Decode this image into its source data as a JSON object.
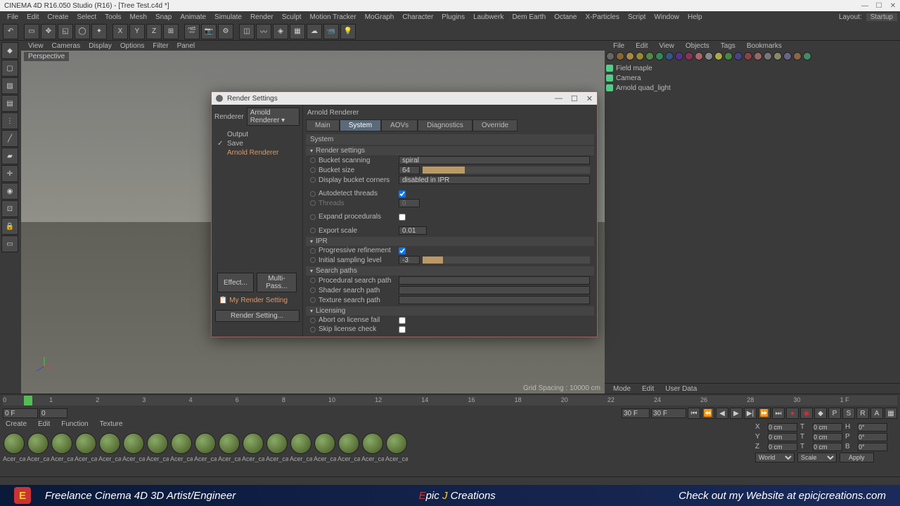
{
  "titlebar": {
    "text": "CINEMA 4D R16.050 Studio (R16) - [Tree Test.c4d *]"
  },
  "menus": [
    "File",
    "Edit",
    "Create",
    "Select",
    "Tools",
    "Mesh",
    "Snap",
    "Animate",
    "Simulate",
    "Render",
    "Sculpt",
    "Motion Tracker",
    "MoGraph",
    "Character",
    "Plugins",
    "Laubwerk",
    "Dem Earth",
    "Octane",
    "X-Particles",
    "Script",
    "Window",
    "Help"
  ],
  "layout": {
    "label": "Layout:",
    "value": "Startup"
  },
  "viewport_menus": [
    "View",
    "Cameras",
    "Display",
    "Options",
    "Filter",
    "Panel"
  ],
  "viewport": {
    "label": "Perspective",
    "grid_spacing": "Grid Spacing : 10000 cm"
  },
  "right_tabs": [
    "File",
    "Edit",
    "View",
    "Objects",
    "Tags",
    "Bookmarks"
  ],
  "objects": [
    {
      "name": "Field maple"
    },
    {
      "name": "Camera"
    },
    {
      "name": "Arnold quad_light"
    }
  ],
  "attr_tabs": [
    "Mode",
    "Edit",
    "User Data"
  ],
  "timeline": {
    "ticks": [
      "0",
      "1",
      "2",
      "3",
      "4",
      "6",
      "8",
      "10",
      "12",
      "14",
      "16",
      "18",
      "20",
      "22",
      "24",
      "26",
      "28",
      "30",
      "1 F"
    ]
  },
  "transport": {
    "start": "0 F",
    "range_start": "0",
    "range_end": "30 F",
    "current": "30 F"
  },
  "material_tabs": [
    "Create",
    "Edit",
    "Function",
    "Texture"
  ],
  "material_name": "Acer_cai",
  "material_count": 17,
  "coords": {
    "x": "0 cm",
    "y": "0 cm",
    "z": "0 cm",
    "tx": "0 cm",
    "ty": "0 cm",
    "tz": "0 cm",
    "h": "0°",
    "p": "0°",
    "b": "0°",
    "mode_world": "World",
    "mode_scale": "Scale",
    "apply": "Apply"
  },
  "footer": {
    "left": "Freelance Cinema 4D 3D Artist/Engineer",
    "center_e": "E",
    "center_pic": "pic ",
    "center_j": "J",
    "center_rest": " Creations",
    "right": "Check out my Website at epicjcreations.com"
  },
  "dialog": {
    "title": "Render Settings",
    "renderer_label": "Renderer",
    "renderer_value": "Arnold Renderer",
    "sidebar_items": {
      "output": "Output",
      "save": "Save",
      "arnold": "Arnold Renderer"
    },
    "effect_btn": "Effect...",
    "multipass_btn": "Multi-Pass...",
    "my_render": "My Render Setting",
    "render_setting_btn": "Render Setting...",
    "content_title": "Arnold Renderer",
    "tabs": [
      "Main",
      "System",
      "AOVs",
      "Diagnostics",
      "Override"
    ],
    "active_tab": "System",
    "system_header": "System",
    "sections": {
      "render_settings": "Render settings",
      "ipr": "IPR",
      "search_paths": "Search paths",
      "licensing": "Licensing"
    },
    "settings": {
      "bucket_scanning": {
        "label": "Bucket scanning",
        "value": "spiral"
      },
      "bucket_size": {
        "label": "Bucket size",
        "value": "64"
      },
      "display_bucket_corners": {
        "label": "Display bucket corners",
        "value": "disabled in IPR"
      },
      "autodetect_threads": {
        "label": "Autodetect threads"
      },
      "threads": {
        "label": "Threads",
        "value": "0"
      },
      "expand_procedurals": {
        "label": "Expand procedurals"
      },
      "export_scale": {
        "label": "Export scale",
        "value": "0.01"
      },
      "progressive_refinement": {
        "label": "Progressive refinement"
      },
      "initial_sampling_level": {
        "label": "Initial sampling level",
        "value": "-3"
      },
      "procedural_search_path": {
        "label": "Procedural search path"
      },
      "shader_search_path": {
        "label": "Shader search path"
      },
      "texture_search_path": {
        "label": "Texture search path"
      },
      "abort_on_license_fail": {
        "label": "Abort on license fail"
      },
      "skip_license_check": {
        "label": "Skip license check"
      }
    }
  }
}
